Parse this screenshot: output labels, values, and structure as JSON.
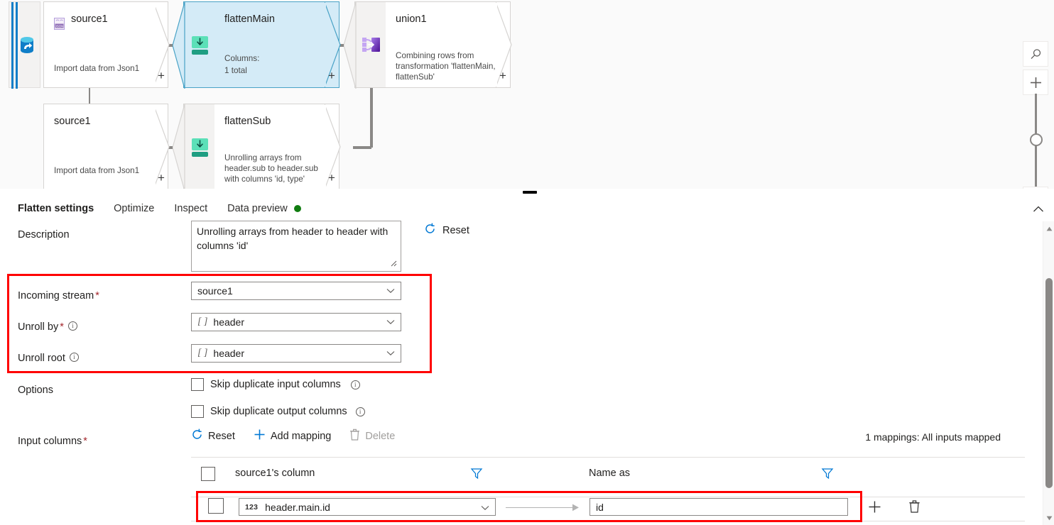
{
  "canvas": {
    "source_rail": {
      "icon": "database-source-icon"
    },
    "nodes": [
      {
        "id": "source1-top",
        "name": "source1",
        "description": "Import data from Json1",
        "icon": "json-file-icon",
        "plus": "+"
      },
      {
        "id": "flattenMain",
        "name": "flattenMain",
        "description_label": "Columns:",
        "description_value": "1 total",
        "icon": "flatten-icon",
        "selected": true,
        "plus": "+"
      },
      {
        "id": "union1",
        "name": "union1",
        "description": "Combining rows from transformation 'flattenMain, flattenSub'",
        "icon": "union-icon",
        "plus": "+"
      },
      {
        "id": "source1-bottom",
        "name": "source1",
        "description": "Import data from Json1",
        "icon": "",
        "plus": "+"
      },
      {
        "id": "flattenSub",
        "name": "flattenSub",
        "description": "Unrolling arrays from header.sub to header.sub with columns 'id, type'",
        "icon": "flatten-icon",
        "plus": "+"
      }
    ],
    "zoom_controls": {
      "search_icon": "search-icon",
      "zoom_in_icon": "plus-icon",
      "slider": "zoom-slider"
    }
  },
  "tabs": [
    {
      "label": "Flatten settings",
      "active": true
    },
    {
      "label": "Optimize",
      "active": false
    },
    {
      "label": "Inspect",
      "active": false
    },
    {
      "label": "Data preview",
      "active": false,
      "status_dot": "green"
    }
  ],
  "settings": {
    "description": {
      "label": "Description",
      "value": "Unrolling arrays from header to header with columns 'id'"
    },
    "reset_top": {
      "label": "Reset",
      "icon": "refresh-icon"
    },
    "incoming_stream": {
      "label": "Incoming stream",
      "required": "*",
      "value": "source1"
    },
    "unroll_by": {
      "label": "Unroll by",
      "required": "*",
      "type_prefix": "[ ]",
      "value": "header"
    },
    "unroll_root": {
      "label": "Unroll root",
      "type_prefix": "[ ]",
      "value": "header"
    },
    "options": {
      "label": "Options",
      "checkboxes": [
        {
          "label": "Skip duplicate input columns",
          "checked": false
        },
        {
          "label": "Skip duplicate output columns",
          "checked": false
        }
      ]
    },
    "input_columns": {
      "label": "Input columns",
      "required": "*",
      "toolbar": [
        {
          "label": "Reset",
          "icon": "refresh-icon",
          "disabled": false
        },
        {
          "label": "Add mapping",
          "icon": "plus-icon",
          "disabled": false
        },
        {
          "label": "Delete",
          "icon": "trash-icon",
          "disabled": true
        }
      ],
      "mapping_note": "1 mappings: All inputs mapped",
      "columns": [
        {
          "header": "source1's column",
          "filter_icon": "filter-icon"
        },
        {
          "header": "Name as",
          "filter_icon": "filter-icon"
        }
      ],
      "rows": [
        {
          "checked": false,
          "source_type": "123",
          "source_value": "header.main.id",
          "target_value": "id",
          "add_icon": "plus-icon",
          "delete_icon": "trash-icon"
        }
      ]
    }
  },
  "colors": {
    "accent": "#0078d4",
    "highlight_rect": "#ff0000",
    "selected_node_fill": "#d4ebf7",
    "selected_node_border": "#49a2c6",
    "status_green": "#107c10",
    "required_red": "#a4262c",
    "flatten_icon": "#2ecc9b",
    "union_icon": "#7a2ec9"
  }
}
